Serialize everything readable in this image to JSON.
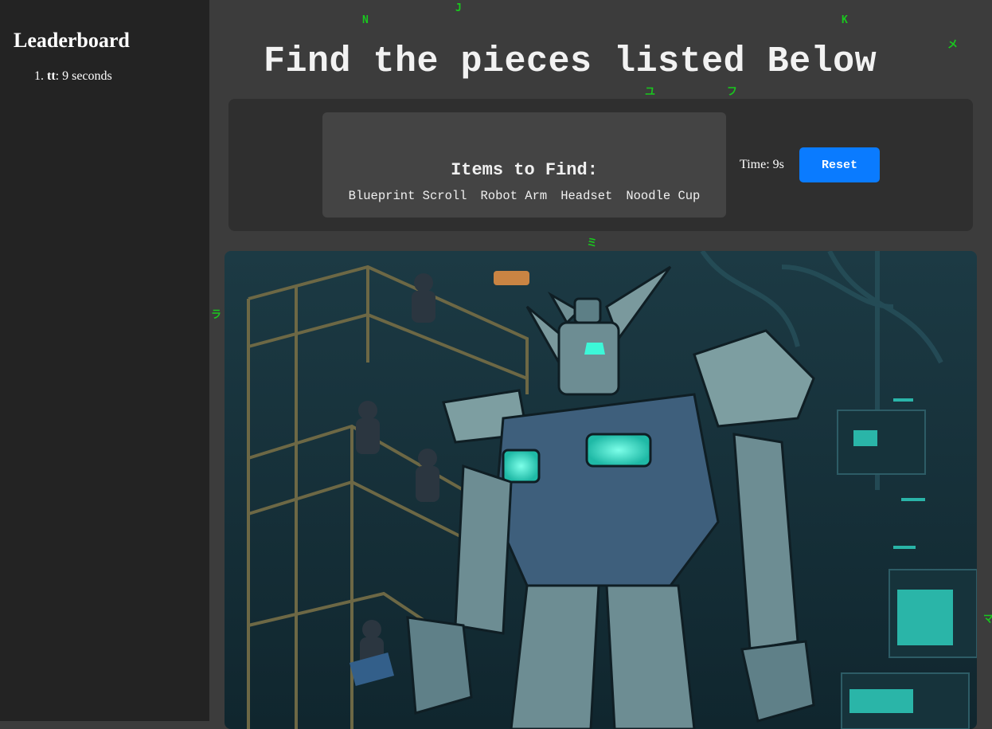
{
  "sidebar": {
    "title": "Leaderboard",
    "entries": [
      {
        "rank": "1.",
        "name": "tt",
        "score": ": 9 seconds"
      }
    ]
  },
  "game": {
    "title": "Find the pieces listed Below",
    "items_heading": "Items to Find:",
    "items": [
      "Blueprint Scroll",
      "Robot Arm",
      "Headset",
      "Noodle Cup"
    ],
    "timer": "Time: 9s",
    "reset_label": "Reset"
  },
  "scene": {
    "description_icon": "mecha-hangar-scene"
  },
  "rain_glyphs": [
    "N",
    "J",
    "K",
    "メ",
    "ユ",
    "フ",
    "ミ",
    "ラ",
    "マ"
  ],
  "colors": {
    "background": "#3c3c3c",
    "sidebar": "#232323",
    "panel": "#2f2f2f",
    "accent": "#0a7bff",
    "rain": "#19c81e"
  }
}
